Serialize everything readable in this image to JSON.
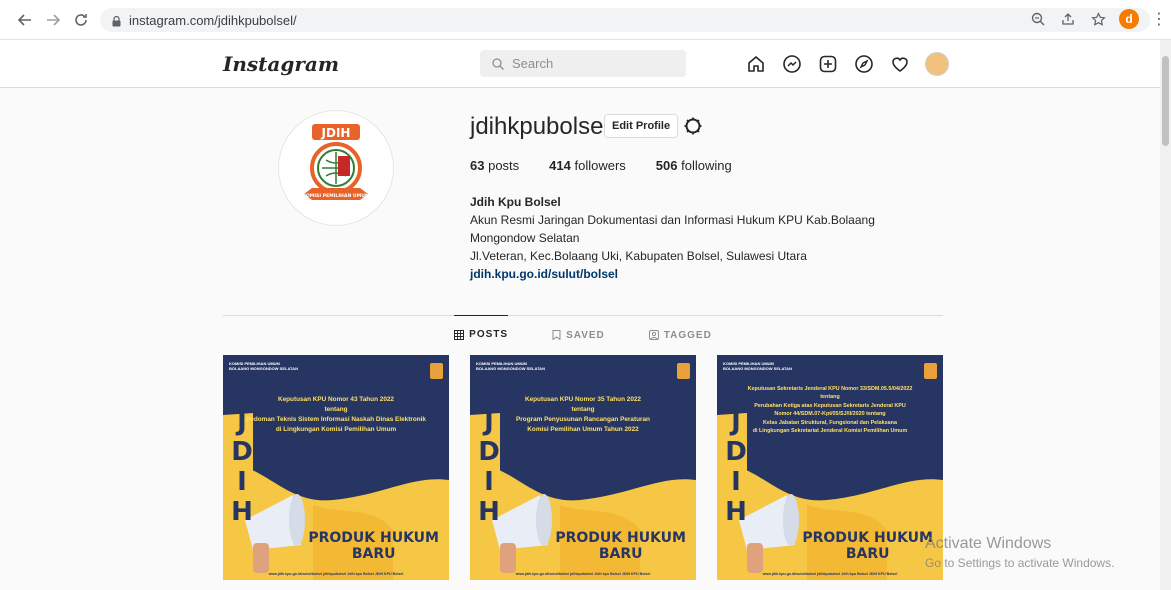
{
  "browser": {
    "url": "instagram.com/jdihkpubolsel/",
    "profile_initial": "d"
  },
  "header": {
    "logo": "Instagram",
    "search_placeholder": "Search"
  },
  "profile": {
    "username": "jdihkpubolsel",
    "edit_profile_label": "Edit Profile",
    "stats": {
      "posts_count": "63",
      "posts_label": "posts",
      "followers_count": "414",
      "followers_label": "followers",
      "following_count": "506",
      "following_label": "following"
    },
    "bio": {
      "full_name": "Jdih Kpu Bolsel",
      "line1": "Akun Resmi Jaringan Dokumentasi dan Informasi Hukum KPU Kab.Bolaang",
      "line2": "Mongondow Selatan",
      "line3": "Jl.Veteran, Kec.Bolaang Uki, Kabupaten Bolsel, Sulawesi Utara",
      "link": "jdih.kpu.go.id/sulut/bolsel"
    },
    "avatar": {
      "banner_text": "JDIH",
      "ribbon_text": "KOMISI PEMILIHAN UMUM"
    }
  },
  "tabs": [
    {
      "label": "POSTS",
      "active": true
    },
    {
      "label": "SAVED",
      "active": false
    },
    {
      "label": "TAGGED",
      "active": false
    }
  ],
  "posts": [
    {
      "header": "KOMISI PEMILIHAN UMUM\nBOLAANG MONGONDOW SELATAN",
      "headline": "Keputusan KPU Nomor 43 Tahun 2022\ntentang\nPedoman Teknis Sistem Informasi Naskah Dinas Elektronik\ndi Lingkungan Komisi Pemilihan Umum",
      "jdih": "J\nD\nI\nH",
      "produk": "PRODUK HUKUM\nBARU",
      "footer": "www.jdih.kpu.go.id/sulut/bolsel   jdihkpubolsel   Jdih kpu Bolsel   JDIH KPU Bolsel"
    },
    {
      "header": "KOMISI PEMILIHAN UMUM\nBOLAANG MONGONDOW SELATAN",
      "headline": "Keputusan KPU Nomor 35 Tahun 2022\ntentang\nProgram Penyusunan Rancangan Peraturan\nKomisi Pemilihan Umum Tahun 2022",
      "jdih": "J\nD\nI\nH",
      "produk": "PRODUK HUKUM\nBARU",
      "footer": "www.jdih.kpu.go.id/sulut/bolsel   jdihkpubolsel   Jdih kpu Bolsel   JDIH KPU Bolsel"
    },
    {
      "header": "KOMISI PEMILIHAN UMUM\nBOLAANG MONGONDOW SELATAN",
      "headline": "Keputusan Sekretaris Jenderal KPU Nomor 33/SDM.05.5/04/2022\ntentang\nPerubahan Ketiga atas Keputusan Sekretaris Jenderal KPU\nNomor 44/SDM.07-Kpt/05/SJ/II/2020 tentang\nKelas Jabatan Struktural, Fungsional dan Pelaksana\ndi Lingkungan Sekretariat Jenderal Komisi Pemilihan Umum",
      "jdih": "J\nD\nI\nH",
      "produk": "PRODUK HUKUM\nBARU",
      "footer": "www.jdih.kpu.go.id/sulut/bolsel   jdihkpubolsel   Jdih kpu Bolsel   JDIH KPU Bolsel"
    }
  ],
  "watermark": {
    "line1": "Activate Windows",
    "line2": "Go to Settings to activate Windows."
  },
  "colors": {
    "post_navy": "#273562",
    "post_yellow": "#f6c745",
    "link": "#00376b"
  }
}
